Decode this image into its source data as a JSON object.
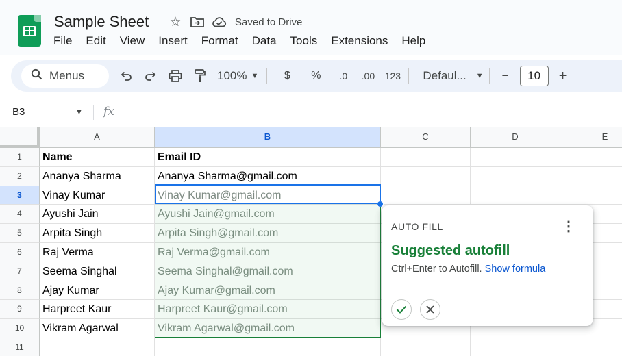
{
  "header": {
    "title": "Sample Sheet",
    "saved_status": "Saved to Drive",
    "icons": [
      "star-icon",
      "move-folder-icon",
      "cloud-done-icon"
    ]
  },
  "menubar": [
    "File",
    "Edit",
    "View",
    "Insert",
    "Format",
    "Data",
    "Tools",
    "Extensions",
    "Help"
  ],
  "toolbar": {
    "menus_label": "Menus",
    "zoom": "100%",
    "currency": "$",
    "percent": "%",
    "decrease_decimal": ".0",
    "increase_decimal": ".00",
    "number_format": "123",
    "font": "Defaul...",
    "font_size": "10",
    "minus": "−",
    "plus": "+"
  },
  "formula_bar": {
    "name_box": "B3",
    "fx": "fx",
    "value": ""
  },
  "columns": [
    "A",
    "B",
    "C",
    "D",
    "E"
  ],
  "rows": [
    {
      "n": "1",
      "a": "Name",
      "b": "Email ID"
    },
    {
      "n": "2",
      "a": "Ananya Sharma",
      "b": "Ananya Sharma@gmail.com"
    },
    {
      "n": "3",
      "a": "Vinay Kumar",
      "b": "Vinay Kumar@gmail.com"
    },
    {
      "n": "4",
      "a": "Ayushi Jain",
      "b": "Ayushi Jain@gmail.com"
    },
    {
      "n": "5",
      "a": "Arpita Singh",
      "b": "Arpita Singh@gmail.com"
    },
    {
      "n": "6",
      "a": "Raj Verma",
      "b": "Raj Verma@gmail.com"
    },
    {
      "n": "7",
      "a": "Seema Singhal",
      "b": "Seema Singhal@gmail.com"
    },
    {
      "n": "8",
      "a": "Ajay Kumar",
      "b": "Ajay Kumar@gmail.com"
    },
    {
      "n": "9",
      "a": "Harpreet Kaur",
      "b": "Harpreet Kaur@gmail.com"
    },
    {
      "n": "10",
      "a": "Vikram Agarwal",
      "b": "Vikram Agarwal@gmail.com"
    },
    {
      "n": "11",
      "a": "",
      "b": ""
    }
  ],
  "selected": {
    "column": "B",
    "row": "3"
  },
  "autofill": {
    "header": "AUTO FILL",
    "title": "Suggested autofill",
    "hint": "Ctrl+Enter to Autofill.",
    "link": "Show formula"
  },
  "colors": {
    "accent": "#1a73e8",
    "suggest_green": "#188038",
    "sheets_logo": "#0f9d58"
  }
}
